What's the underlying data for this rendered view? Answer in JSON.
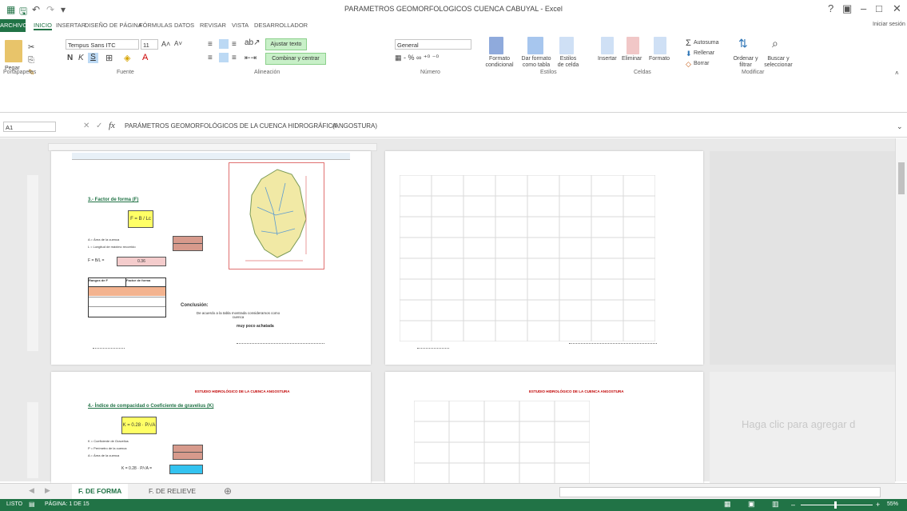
{
  "window": {
    "title": "PARAMETROS GEOMORFOLOGICOS CUENCA CABUYAL - Excel",
    "controls": [
      "?",
      "▣",
      "–",
      "□",
      "✕"
    ]
  },
  "ribbon_tabs": [
    "ARCHIVO",
    "INICIO",
    "INSERTAR",
    "DISEÑO DE PÁGINA",
    "FÓRMULAS",
    "DATOS",
    "REVISAR",
    "VISTA",
    "DESARROLLADOR"
  ],
  "signin": "Iniciar sesión",
  "ribbon": {
    "clipboard": {
      "paste": "Pegar",
      "label": "Portapapeles"
    },
    "font": {
      "name": "Tempus Sans ITC",
      "size": "11",
      "label": "Fuente"
    },
    "alignment": {
      "wrap": "Ajustar texto",
      "merge": "Combinar y centrar",
      "label": "Alineación"
    },
    "number": {
      "format": "General",
      "label": "Número"
    },
    "styles": {
      "conditional": "Formato condicional",
      "as_table": "Dar formato como tabla",
      "cell_styles": "Estilos de celda",
      "label": "Estilos"
    },
    "cells": {
      "insert": "Insertar",
      "delete": "Eliminar",
      "format": "Formato",
      "label": "Celdas"
    },
    "editing": {
      "autosum": "Autosuma",
      "fill": "Rellenar",
      "clear": "Borrar",
      "sort": "Ordenar y filtrar",
      "find": "Buscar y seleccionar",
      "label": "Modificar"
    }
  },
  "formula_bar": {
    "name_box": "A1",
    "fx": "fx",
    "content": "PARÁMETROS GEOMORFOLÓGICOS DE LA CUENCA HIDROGRÁFICA",
    "content2": "(ANGOSTURA)"
  },
  "sheet": {
    "section3_title": "3.- Factor de forma (F)",
    "formula_F": "F = B / Lc",
    "area_label": "A = Área de la cuenca",
    "length_label": "L = Longitud de máximo recorrido",
    "result_F": "0.36",
    "table_headers": [
      "Rangos de F",
      "Factor de forma"
    ],
    "conclusion_title": "Conclusión:",
    "conclusion_text": "De acuerdo a la tabla mostrada consideramos como cuenca",
    "conclusion_bold": "muy poco achatada",
    "section4_title": "4.- Índice de compacidad o Coeficiente de gravelius (K)",
    "formula_K": "K = 0.28 · P/√A",
    "k_label": "K = Coeficiente de Gravelius",
    "p_label": "P = Perímetro de la cuenca",
    "a_label": "A = Área de la cuenca",
    "page_title_red": "ESTUDIO HIDROLÓGICO DE LA CUENCA ANGOSTURA",
    "placeholder": "Haga clic para agregar d"
  },
  "sheet_tabs": [
    {
      "label": "F. DE FORMA",
      "active": true
    },
    {
      "label": "F. DE RELIEVE",
      "active": false
    }
  ],
  "status": {
    "mode": "LISTO",
    "page": "PÁGINA: 1 DE 15",
    "zoom": "55%"
  },
  "colors": {
    "excel_green": "#217346",
    "yellow_formula": "#ffff66",
    "salmon_cells": "#d79a8c",
    "red_text": "#c00000",
    "cyan_result": "#33c3f0"
  }
}
